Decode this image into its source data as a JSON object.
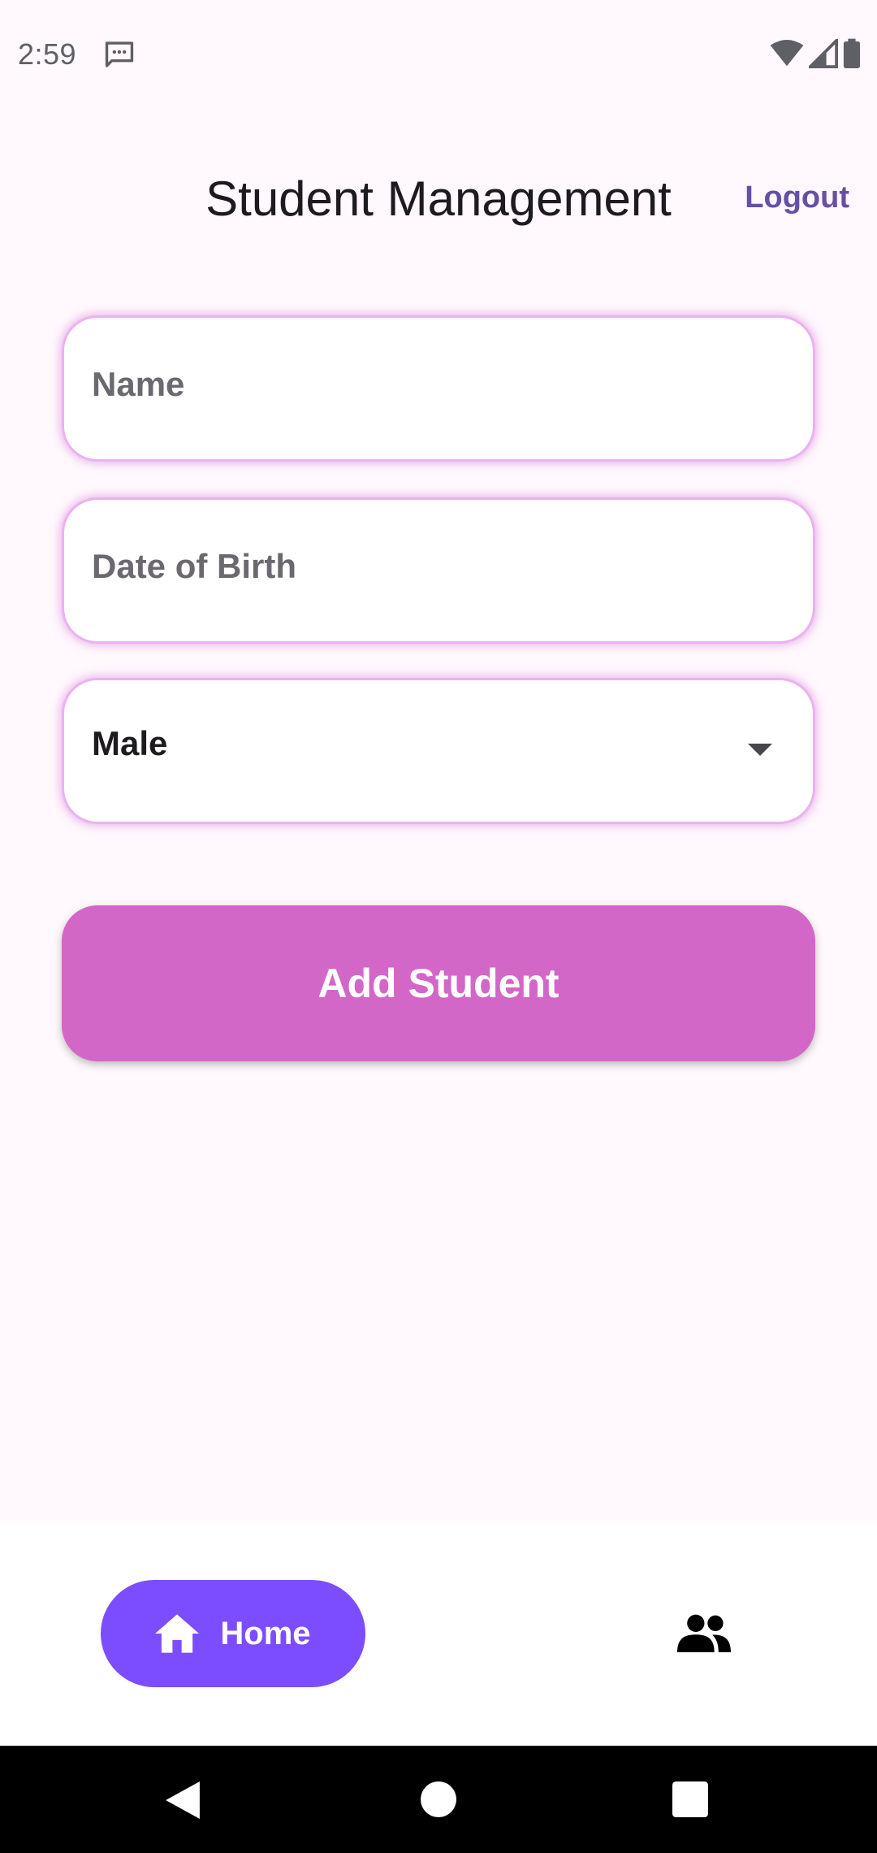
{
  "status_bar": {
    "time": "2:59"
  },
  "header": {
    "title": "Student Management",
    "logout_label": "Logout"
  },
  "form": {
    "name_placeholder": "Name",
    "dob_placeholder": "Date of Birth",
    "gender_value": "Male"
  },
  "actions": {
    "add_label": "Add Student"
  },
  "bottom_nav": {
    "items": [
      {
        "label": "Home",
        "icon": "home-icon",
        "selected": true
      },
      {
        "label": "",
        "icon": "people-icon",
        "selected": false
      }
    ]
  },
  "colors": {
    "accent": "#7c4dff",
    "button": "#d267c8",
    "logout": "#6750a4",
    "field_border": "#e9b3ee",
    "background": "#fff8fc"
  }
}
